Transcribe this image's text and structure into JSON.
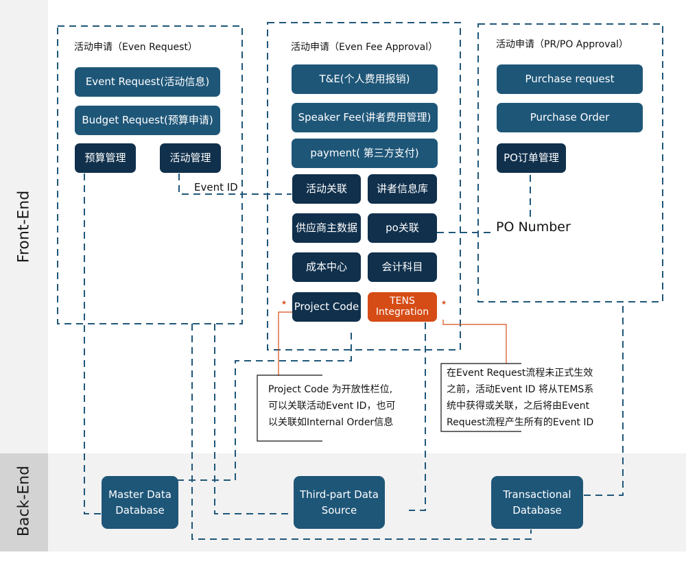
{
  "side_labels": {
    "front": "Front-End",
    "back": "Back-End"
  },
  "colors": {
    "light_box": "#1e5678",
    "dark_box": "#10304c",
    "highlight": "#d64c16",
    "connector": "#1e5678"
  },
  "groups": {
    "event_request": {
      "title": "活动申请（Even Request）",
      "items": [
        "Event Request(活动信息)",
        "Budget Request(预算申请)",
        "预算管理",
        "活动管理"
      ]
    },
    "fee_approval": {
      "title": "活动申请（Even Fee Approval）",
      "items": [
        "T&E(个人费用报销)",
        "Speaker Fee(讲者费用管理)",
        "payment( 第三方支付)",
        "活动关联",
        "讲者信息库",
        "供应商主数据",
        "po关联",
        "成本中心",
        "会计科目",
        "Project Code",
        "TENS Integration"
      ]
    },
    "pr_po": {
      "title": "活动申请（PR/PO Approval）",
      "items": [
        "Purchase request",
        "Purchase Order",
        "PO订单管理"
      ]
    }
  },
  "connector_labels": {
    "event_id": "Event ID",
    "po_number": "PO Number"
  },
  "markers": {
    "star": "★"
  },
  "notes": {
    "project_code": [
      "Project Code 为开放性栏位,",
      "可以关联活动Event ID，也可",
      "以关联如Internal Order信息"
    ],
    "tens": [
      "在Event   Request流程未正式生效",
      "之前，活动Event ID   将从TEMS系",
      "统中获得或关联，之后将由Event",
      "Request流程产生所有的Event ID"
    ]
  },
  "databases": [
    "Master Data Database",
    "Third-part Data Source",
    "Transactional Database"
  ],
  "databases_lines": [
    [
      "Master Data",
      "Database"
    ],
    [
      "Third-part Data",
      "Source"
    ],
    [
      "Transactional",
      "Database"
    ]
  ]
}
